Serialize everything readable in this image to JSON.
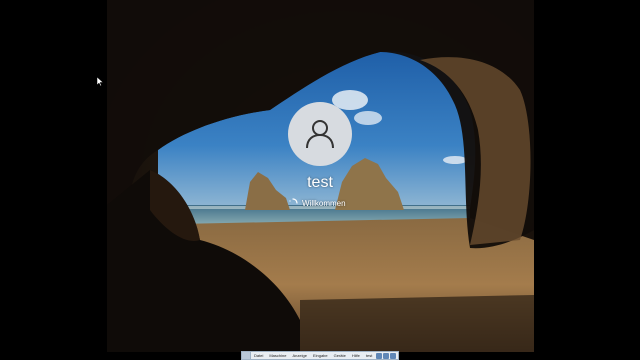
{
  "lock_screen": {
    "username": "test",
    "status_text": "Willkommen",
    "avatar_icon": "user-silhouette-icon"
  },
  "vm_toolbar": {
    "menus": [
      "Datei",
      "Maschine",
      "Anzeige",
      "Eingabe",
      "Geräte",
      "Hilfe"
    ],
    "title": "test",
    "buttons": [
      "minimize-icon",
      "restore-icon",
      "close-icon"
    ]
  },
  "colors": {
    "sky": "#2a6fb5",
    "sand": "#9a7446",
    "sea": "#6a9aa8",
    "cave_dark": "#0b0806"
  }
}
